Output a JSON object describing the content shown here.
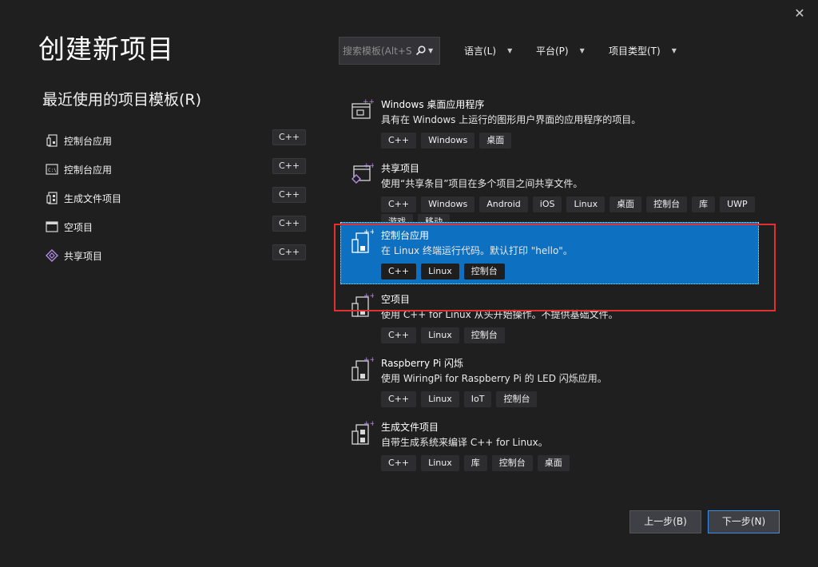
{
  "dialog": {
    "title": "创建新项目",
    "close_glyph": "✕"
  },
  "recent": {
    "heading": "最近使用的项目模板(R)",
    "items": [
      {
        "label": "控制台应用",
        "badge": "C++",
        "icon": "console-app-icon"
      },
      {
        "label": "控制台应用",
        "badge": "C++",
        "icon": "console-window-icon"
      },
      {
        "label": "生成文件项目",
        "badge": "C++",
        "icon": "makefile-project-icon"
      },
      {
        "label": "空项目",
        "badge": "C++",
        "icon": "empty-project-icon"
      },
      {
        "label": "共享项目",
        "badge": "C++",
        "icon": "shared-project-icon"
      }
    ]
  },
  "search": {
    "placeholder": "搜索模板(Alt+S)"
  },
  "filters": {
    "language": "语言(L)",
    "platform": "平台(P)",
    "project_type": "项目类型(T)"
  },
  "templates": [
    {
      "title": "Windows 桌面应用程序",
      "desc": "具有在 Windows 上运行的图形用户界面的应用程序的项目。",
      "tags": [
        "C++",
        "Windows",
        "桌面"
      ],
      "icon": "windows-desktop-app-icon"
    },
    {
      "title": "共享项目",
      "desc": "使用“共享条目”项目在多个项目之间共享文件。",
      "tags": [
        "C++",
        "Windows",
        "Android",
        "iOS",
        "Linux",
        "桌面",
        "控制台",
        "库",
        "UWP",
        "游戏",
        "移动"
      ],
      "icon": "shared-project-icon"
    },
    {
      "title": "控制台应用",
      "desc": "在 Linux 终端运行代码。默认打印 \"hello\"。",
      "tags": [
        "C++",
        "Linux",
        "控制台"
      ],
      "icon": "linux-console-app-icon",
      "selected": true
    },
    {
      "title": "空项目",
      "desc": "使用 C++ for Linux 从头开始操作。不提供基础文件。",
      "tags": [
        "C++",
        "Linux",
        "控制台"
      ],
      "icon": "linux-empty-project-icon"
    },
    {
      "title": "Raspberry Pi 闪烁",
      "desc": "使用 WiringPi for Raspberry Pi 的 LED 闪烁应用。",
      "tags": [
        "C++",
        "Linux",
        "IoT",
        "控制台"
      ],
      "icon": "raspberry-pi-blink-icon"
    },
    {
      "title": "生成文件项目",
      "desc": "自带生成系统来编译 C++ for Linux。",
      "tags": [
        "C++",
        "Linux",
        "库",
        "控制台",
        "桌面"
      ],
      "icon": "linux-makefile-project-icon"
    }
  ],
  "buttons": {
    "back": "上一步(B)",
    "next": "下一步(N)"
  },
  "colors": {
    "background": "#1f1f1f",
    "selection": "#0e70c0",
    "highlight_frame": "#e03030",
    "tag_background": "#2d2d30"
  }
}
